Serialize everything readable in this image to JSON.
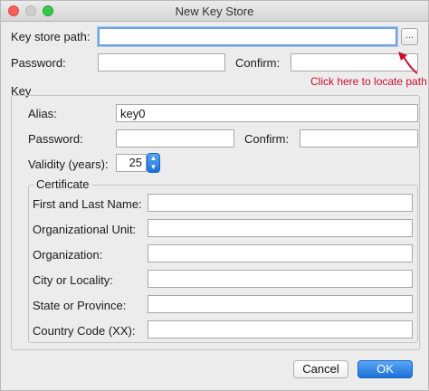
{
  "window": {
    "title": "New Key Store"
  },
  "keystore": {
    "path_label": "Key store path:",
    "path_value": "",
    "browse_label": "...",
    "password_label": "Password:",
    "password_value": "",
    "confirm_label": "Confirm:",
    "confirm_value": "",
    "hint": "Click here to locate path"
  },
  "key": {
    "group_label": "Key",
    "alias_label": "Alias:",
    "alias_value": "key0",
    "password_label": "Password:",
    "password_value": "",
    "confirm_label": "Confirm:",
    "confirm_value": "",
    "validity_label": "Validity (years):",
    "validity_value": "25"
  },
  "certificate": {
    "group_label": "Certificate",
    "fields": [
      {
        "label": "First and Last Name:",
        "value": ""
      },
      {
        "label": "Organizational Unit:",
        "value": ""
      },
      {
        "label": "Organization:",
        "value": ""
      },
      {
        "label": "City or Locality:",
        "value": ""
      },
      {
        "label": "State or Province:",
        "value": ""
      },
      {
        "label": "Country Code (XX):",
        "value": ""
      }
    ]
  },
  "buttons": {
    "cancel": "Cancel",
    "ok": "OK"
  },
  "colors": {
    "hint": "#c8102e",
    "accent": "#1a72d9",
    "focus_ring": "#6ea1e0"
  }
}
